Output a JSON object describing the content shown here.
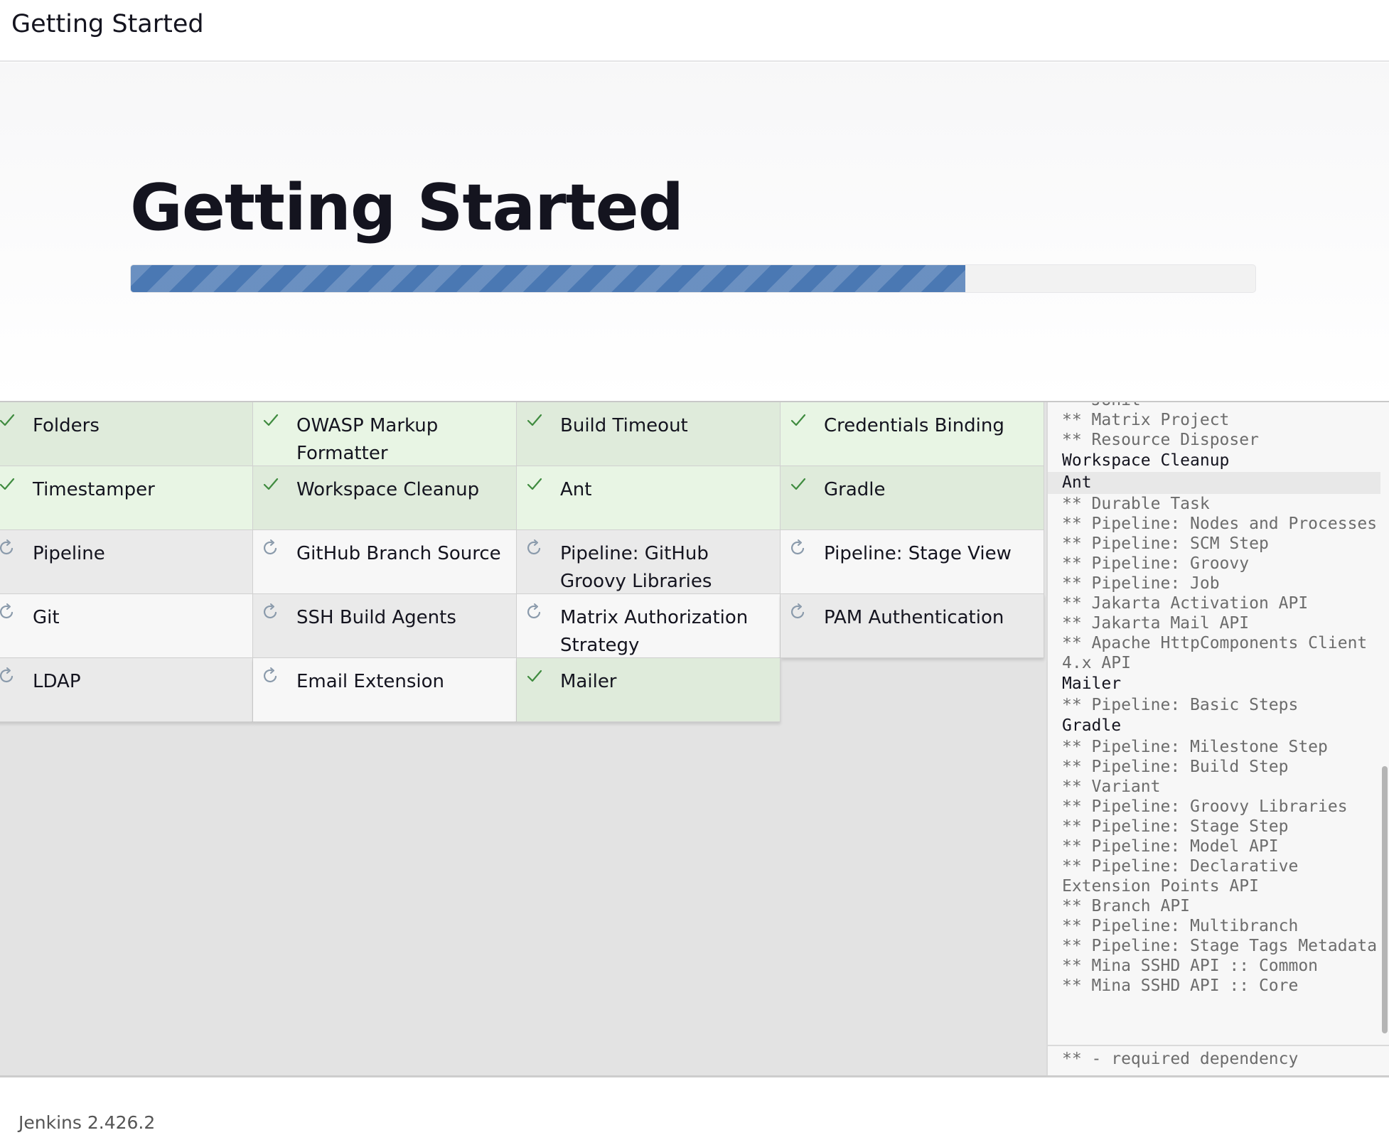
{
  "header": {
    "title": "Getting Started"
  },
  "hero": {
    "title": "Getting Started",
    "progress_percent": 74.2
  },
  "plugins": [
    {
      "name": "Folders",
      "status": "installed"
    },
    {
      "name": "OWASP Markup Formatter",
      "status": "installed"
    },
    {
      "name": "Build Timeout",
      "status": "installed"
    },
    {
      "name": "Credentials Binding",
      "status": "installed"
    },
    {
      "name": "Timestamper",
      "status": "installed"
    },
    {
      "name": "Workspace Cleanup",
      "status": "installed"
    },
    {
      "name": "Ant",
      "status": "installed"
    },
    {
      "name": "Gradle",
      "status": "installed"
    },
    {
      "name": "Pipeline",
      "status": "pending"
    },
    {
      "name": "GitHub Branch Source",
      "status": "pending"
    },
    {
      "name": "Pipeline: GitHub Groovy Libraries",
      "status": "pending"
    },
    {
      "name": "Pipeline: Stage View",
      "status": "pending"
    },
    {
      "name": "Git",
      "status": "pending"
    },
    {
      "name": "SSH Build Agents",
      "status": "pending"
    },
    {
      "name": "Matrix Authorization Strategy",
      "status": "pending"
    },
    {
      "name": "PAM Authentication",
      "status": "pending"
    },
    {
      "name": "LDAP",
      "status": "pending"
    },
    {
      "name": "Email Extension",
      "status": "pending"
    },
    {
      "name": "Mailer",
      "status": "installed"
    }
  ],
  "deps": {
    "lines": [
      {
        "text": "** JUnit",
        "kind": "dep"
      },
      {
        "text": "** Matrix Project",
        "kind": "dep"
      },
      {
        "text": "** Resource Disposer",
        "kind": "dep"
      },
      {
        "text": "Workspace Cleanup",
        "kind": "plugin"
      },
      {
        "text": "Ant",
        "kind": "current"
      },
      {
        "text": "** Durable Task",
        "kind": "dep"
      },
      {
        "text": "** Pipeline: Nodes and Processes",
        "kind": "dep"
      },
      {
        "text": "** Pipeline: SCM Step",
        "kind": "dep"
      },
      {
        "text": "** Pipeline: Groovy",
        "kind": "dep"
      },
      {
        "text": "** Pipeline: Job",
        "kind": "dep"
      },
      {
        "text": "** Jakarta Activation API",
        "kind": "dep"
      },
      {
        "text": "** Jakarta Mail API",
        "kind": "dep"
      },
      {
        "text": "** Apache HttpComponents Client 4.x API",
        "kind": "dep"
      },
      {
        "text": "Mailer",
        "kind": "plugin"
      },
      {
        "text": "** Pipeline: Basic Steps",
        "kind": "dep"
      },
      {
        "text": "Gradle",
        "kind": "plugin"
      },
      {
        "text": "** Pipeline: Milestone Step",
        "kind": "dep"
      },
      {
        "text": "** Pipeline: Build Step",
        "kind": "dep"
      },
      {
        "text": "** Variant",
        "kind": "dep"
      },
      {
        "text": "** Pipeline: Groovy Libraries",
        "kind": "dep"
      },
      {
        "text": "** Pipeline: Stage Step",
        "kind": "dep"
      },
      {
        "text": "** Pipeline: Model API",
        "kind": "dep"
      },
      {
        "text": "** Pipeline: Declarative Extension Points API",
        "kind": "dep"
      },
      {
        "text": "** Branch API",
        "kind": "dep"
      },
      {
        "text": "** Pipeline: Multibranch",
        "kind": "dep"
      },
      {
        "text": "** Pipeline: Stage Tags Metadata",
        "kind": "dep"
      },
      {
        "text": "** Mina SSHD API :: Common",
        "kind": "dep"
      },
      {
        "text": "** Mina SSHD API :: Core",
        "kind": "dep"
      }
    ],
    "legend": "** - required dependency"
  },
  "footer": {
    "version": "Jenkins 2.426.2"
  },
  "colors": {
    "progress": "#4a78b3",
    "installed": "#dfebdb",
    "check": "#3f8b3f",
    "spinner": "#8a9aab"
  }
}
